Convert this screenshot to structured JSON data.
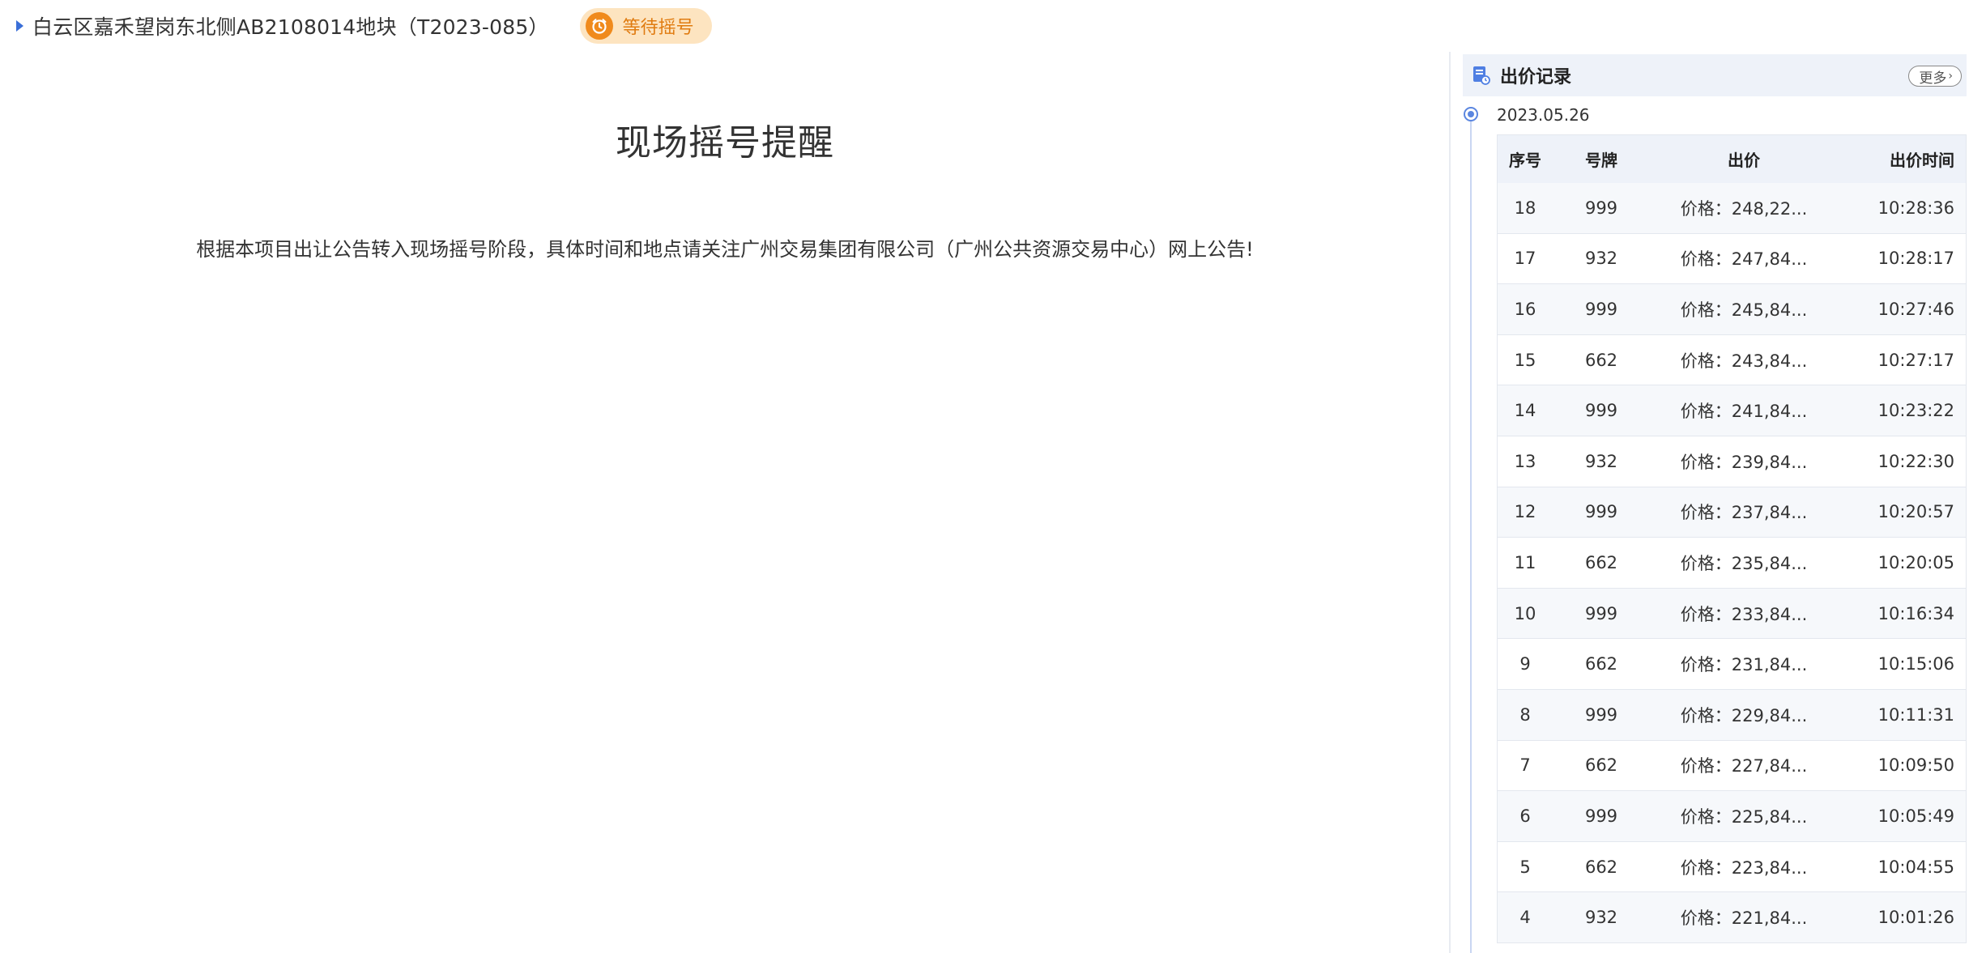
{
  "header": {
    "title": "白云区嘉禾望岗东北侧AB2108014地块（T2023-085）",
    "status": "等待摇号"
  },
  "main": {
    "notice_title": "现场摇号提醒",
    "notice_body": "根据本项目出让公告转入现场摇号阶段，具体时间和地点请关注广州交易集团有限公司（广州公共资源交易中心）网上公告!"
  },
  "panel": {
    "title": "出价记录",
    "more_label": "更多",
    "date": "2023.05.26",
    "columns": [
      "序号",
      "号牌",
      "出价",
      "出价时间"
    ],
    "rows": [
      {
        "seq": "18",
        "plate": "999",
        "price": "价格：248,22...",
        "time": "10:28:36"
      },
      {
        "seq": "17",
        "plate": "932",
        "price": "价格：247,84...",
        "time": "10:28:17"
      },
      {
        "seq": "16",
        "plate": "999",
        "price": "价格：245,84...",
        "time": "10:27:46"
      },
      {
        "seq": "15",
        "plate": "662",
        "price": "价格：243,84...",
        "time": "10:27:17"
      },
      {
        "seq": "14",
        "plate": "999",
        "price": "价格：241,84...",
        "time": "10:23:22"
      },
      {
        "seq": "13",
        "plate": "932",
        "price": "价格：239,84...",
        "time": "10:22:30"
      },
      {
        "seq": "12",
        "plate": "999",
        "price": "价格：237,84...",
        "time": "10:20:57"
      },
      {
        "seq": "11",
        "plate": "662",
        "price": "价格：235,84...",
        "time": "10:20:05"
      },
      {
        "seq": "10",
        "plate": "999",
        "price": "价格：233,84...",
        "time": "10:16:34"
      },
      {
        "seq": "9",
        "plate": "662",
        "price": "价格：231,84...",
        "time": "10:15:06"
      },
      {
        "seq": "8",
        "plate": "999",
        "price": "价格：229,84...",
        "time": "10:11:31"
      },
      {
        "seq": "7",
        "plate": "662",
        "price": "价格：227,84...",
        "time": "10:09:50"
      },
      {
        "seq": "6",
        "plate": "999",
        "price": "价格：225,84...",
        "time": "10:05:49"
      },
      {
        "seq": "5",
        "plate": "662",
        "price": "价格：223,84...",
        "time": "10:04:55"
      },
      {
        "seq": "4",
        "plate": "932",
        "price": "价格：221,84...",
        "time": "10:01:26"
      }
    ]
  },
  "colors": {
    "accent_blue": "#3a6fd8",
    "status_orange": "#f08a1c",
    "status_bg": "#fde4c0"
  },
  "icons": {
    "caret": "caret-right-icon",
    "clock": "alarm-clock-icon",
    "panel": "document-icon"
  }
}
